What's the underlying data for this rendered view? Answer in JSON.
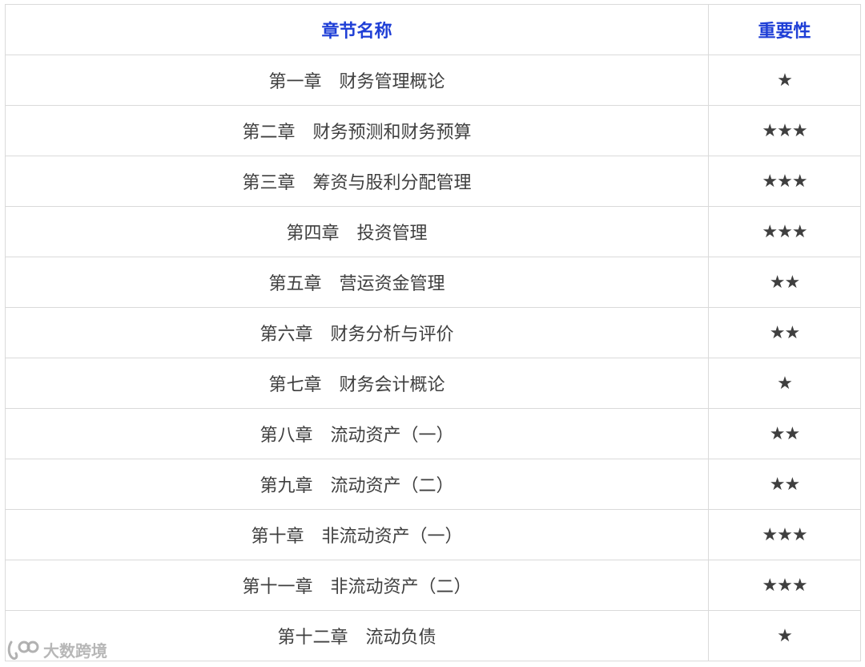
{
  "table": {
    "headers": {
      "name": "章节名称",
      "importance": "重要性"
    },
    "rows": [
      {
        "chapter": "第一章　财务管理概论",
        "importance": "★"
      },
      {
        "chapter": "第二章　财务预测和财务预算",
        "importance": "★★★"
      },
      {
        "chapter": "第三章　筹资与股利分配管理",
        "importance": "★★★"
      },
      {
        "chapter": "第四章　投资管理",
        "importance": "★★★"
      },
      {
        "chapter": "第五章　营运资金管理",
        "importance": "★★"
      },
      {
        "chapter": "第六章　财务分析与评价",
        "importance": "★★"
      },
      {
        "chapter": "第七章　财务会计概论",
        "importance": "★"
      },
      {
        "chapter": "第八章　流动资产（一）",
        "importance": "★★"
      },
      {
        "chapter": "第九章　流动资产（二）",
        "importance": "★★"
      },
      {
        "chapter": "第十章　非流动资产（一）",
        "importance": "★★★"
      },
      {
        "chapter": "第十一章　非流动资产（二）",
        "importance": "★★★"
      },
      {
        "chapter": "第十二章　流动负债",
        "importance": "★"
      }
    ]
  },
  "watermark": {
    "text": "大数跨境",
    "logo_icon": "double-loop-logo-icon"
  },
  "colors": {
    "header_text": "#1f3fd6",
    "body_text": "#3f3f3f",
    "border": "#dadada"
  }
}
